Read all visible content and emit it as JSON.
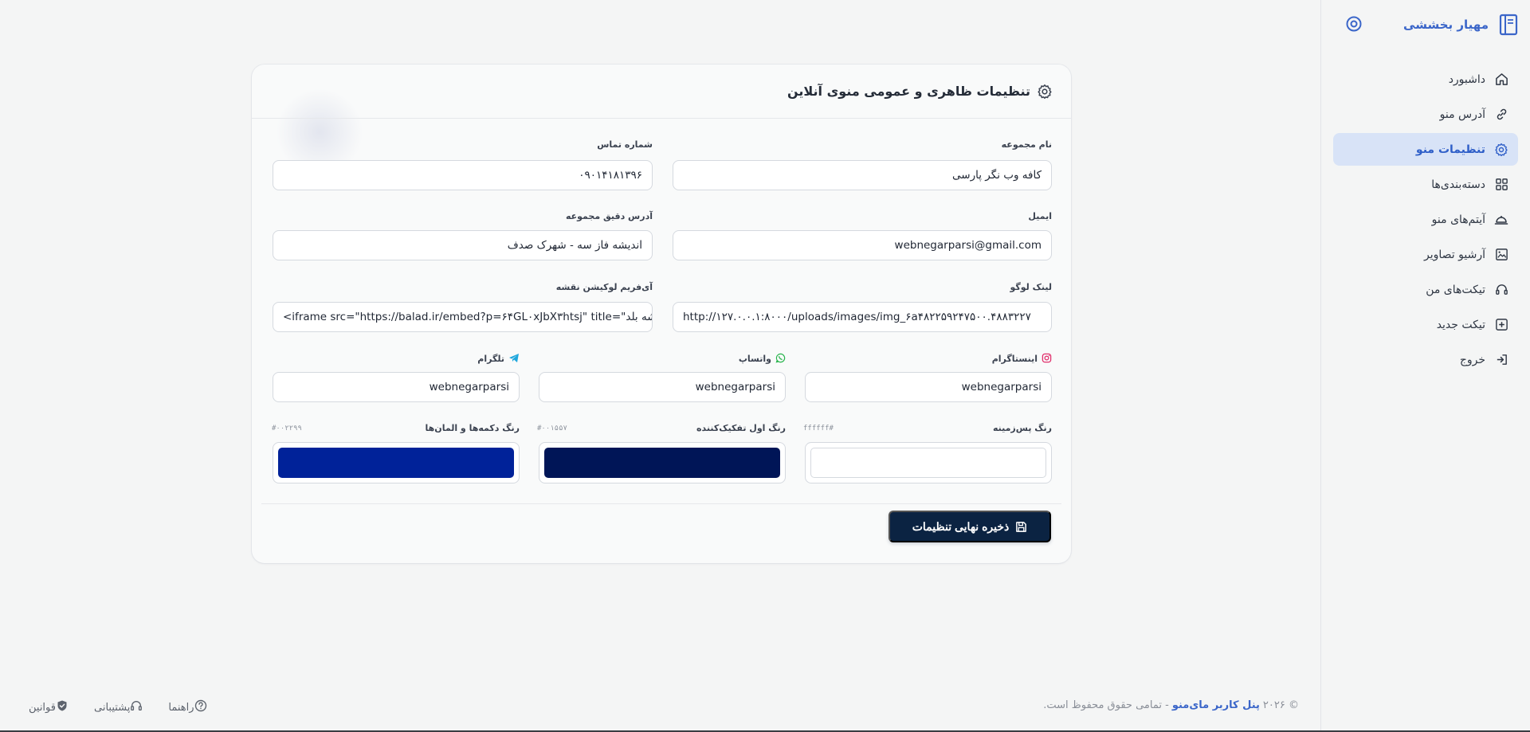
{
  "sidebar": {
    "brand_name": "مهیار بخششی",
    "items": [
      {
        "label": "داشبورد",
        "icon": "home-icon"
      },
      {
        "label": "آدرس منو",
        "icon": "link-icon"
      },
      {
        "label": "تنظیمات منو",
        "icon": "gear-icon",
        "active": true
      },
      {
        "label": "دسته‌بندی‌ها",
        "icon": "grid-icon"
      },
      {
        "label": "آیتم‌های منو",
        "icon": "cloche-icon"
      },
      {
        "label": "آرشیو تصاویر",
        "icon": "image-icon"
      },
      {
        "label": "تیکت‌های من",
        "icon": "headset-icon"
      },
      {
        "label": "تیکت جدید",
        "icon": "plus-square-icon"
      },
      {
        "label": "خروج",
        "icon": "logout-icon"
      }
    ]
  },
  "card": {
    "title": "تنظیمات ظاهری و عمومی منوی آنلاین",
    "fields": {
      "store_name": {
        "label": "نام مجموعه",
        "value": "کافه وب نگر پارسی"
      },
      "phone": {
        "label": "شماره تماس",
        "value": "۰۹۰۱۴۱۸۱۳۹۶"
      },
      "email": {
        "label": "ایمیل",
        "value": "webnegarparsi@gmail.com"
      },
      "address": {
        "label": "آدرس دقیق مجموعه",
        "value": "اندیشه فاز سه - شهرک صدف"
      },
      "logo_link": {
        "label": "لینک لوگو",
        "value": "http://۱۲۷.۰.۰.۱:۸۰۰۰/uploads/images/img_۶a۴۸۲۲۵۹۲۴۷۵۰۰.۴۸۸۳۲۲۷"
      },
      "map_iframe": {
        "label": "آی‌فریم لوکیشن نقشه",
        "value": "<iframe src=\"https://balad.ir/embed?p=۶۴GL۰xJbX۳htsj\" title=\"شه بلد\""
      },
      "instagram": {
        "label": "اینستاگرام",
        "value": "webnegarparsi"
      },
      "whatsapp": {
        "label": "واتساپ",
        "value": "webnegarparsi"
      },
      "telegram": {
        "label": "تلگرام",
        "value": "webnegarparsi"
      }
    },
    "colors": {
      "background": {
        "label": "رنگ پس‌زمینه",
        "hex_text": "ffffff#",
        "value": "#ffffff"
      },
      "primary": {
        "label": "رنگ اول تفکیک‌کننده",
        "hex_text": "#۰۰۱۵۵۷",
        "value": "#001557"
      },
      "buttons": {
        "label": "رنگ دکمه‌ها و المان‌ها",
        "hex_text": "#۰۰۲۲۹۹",
        "value": "#002299"
      }
    },
    "save_label": "ذخیره نهایی تنظیمات"
  },
  "footer": {
    "copy_prefix": "© ۲۰۲۶",
    "copy_brand": "پنل کاربر مای‌منو",
    "copy_suffix": "- تمامی حقوق محفوظ است.",
    "links": [
      {
        "label": "راهنما",
        "icon": "help-circle-icon"
      },
      {
        "label": "پشتیبانی",
        "icon": "headset-icon"
      },
      {
        "label": "قوانین",
        "icon": "shield-icon"
      }
    ]
  },
  "colors": {
    "accent": "#3b66c9",
    "active_bg": "#d8e3f7",
    "save_button": "#0b2342"
  }
}
